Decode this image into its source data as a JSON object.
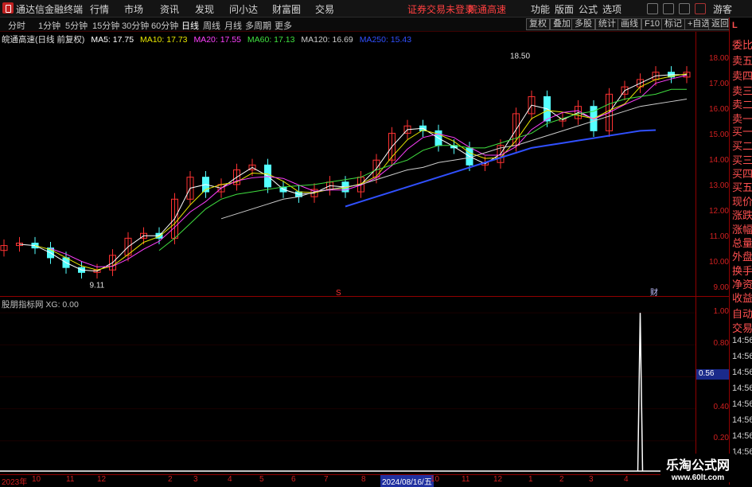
{
  "menubar": {
    "app_title": "通达信金融终端",
    "menus": [
      "行情",
      "市场",
      "资讯",
      "发现",
      "问小达",
      "财富圈",
      "交易"
    ],
    "notice": "证券交易未登录",
    "stock_name": "皖通高速",
    "right_menus": [
      "功能",
      "版面",
      "公式",
      "选项"
    ],
    "user": "游客"
  },
  "toolbar": {
    "periods": [
      "分时",
      "1分钟",
      "5分钟",
      "15分钟",
      "30分钟",
      "60分钟",
      "日线",
      "周线",
      "月线",
      "多周期",
      "更多"
    ],
    "selected": "日线",
    "buttons": [
      "复权",
      "叠加",
      "多股",
      "统计",
      "画线",
      "F10",
      "标记",
      "+自选",
      "返回"
    ]
  },
  "ma_legend": {
    "title": "皖通高速(日线 前复权)",
    "items": [
      {
        "label": "MA5: 17.75",
        "color": "#ffffff"
      },
      {
        "label": "MA10: 17.73",
        "color": "#e6e600"
      },
      {
        "label": "MA20: 17.55",
        "color": "#ff40ff"
      },
      {
        "label": "MA60: 17.13",
        "color": "#40e040"
      },
      {
        "label": "MA120: 16.69",
        "color": "#cccccc"
      },
      {
        "label": "MA250: 15.43",
        "color": "#3050ff"
      }
    ]
  },
  "main_yaxis": [
    "18.00",
    "17.00",
    "16.00",
    "15.00",
    "14.00",
    "13.00",
    "12.00",
    "11.00",
    "10.00",
    "9.00"
  ],
  "annotations": {
    "high": "18.50",
    "low": "9.11",
    "marker_s": "S",
    "marker_cai": "财"
  },
  "indicator": {
    "legend": "股朋指标网 XG: 0.00",
    "yaxis": [
      "1.00",
      "0.80",
      "0.60",
      "0.40",
      "0.20"
    ],
    "current_value": "0.56"
  },
  "right_panel": [
    "L",
    "委比",
    "卖五",
    "卖四",
    "卖三",
    "卖二",
    "卖一",
    "买一",
    "买二",
    "买三",
    "买四",
    "买五",
    "现价",
    "涨跌",
    "涨幅",
    "总量",
    "外盘",
    "换手",
    "净资",
    "收益",
    "自动",
    "交易",
    "14:56",
    "14:56",
    "14:56",
    "14:56",
    "14:56",
    "14:56",
    "14:56",
    "14:56"
  ],
  "xaxis": [
    "2023年",
    "10",
    "11",
    "12",
    "2",
    "3",
    "4",
    "5",
    "6",
    "7",
    "8",
    "9",
    "2024/08/16/五",
    "10",
    "11",
    "12",
    "1",
    "2",
    "3",
    "4"
  ],
  "watermark": {
    "title": "乐淘公式网",
    "url": "www.60lt.com"
  },
  "chart_data": {
    "type": "candlestick",
    "ylim": [
      8.6,
      18.9
    ],
    "ma_series": [
      "MA5",
      "MA10",
      "MA20",
      "MA60",
      "MA120",
      "MA250"
    ],
    "close": [
      10.7,
      10.8,
      10.6,
      10.2,
      9.8,
      9.6,
      9.7,
      10.3,
      11.0,
      11.2,
      11.0,
      12.6,
      13.5,
      12.9,
      13.2,
      13.8,
      14.0,
      13.1,
      12.9,
      12.7,
      13.0,
      13.3,
      12.9,
      13.5,
      14.2,
      15.3,
      15.6,
      15.4,
      14.8,
      14.7,
      14.0,
      14.1,
      14.8,
      16.1,
      16.8,
      15.8,
      15.9,
      16.4,
      15.4,
      16.9,
      17.2,
      17.5,
      17.8,
      17.6,
      17.8
    ],
    "ma60": [
      null,
      null,
      null,
      null,
      null,
      null,
      null,
      null,
      null,
      null,
      10.5,
      11.0,
      11.6,
      12.2,
      12.6,
      12.8,
      12.9,
      13.0,
      13.1,
      13.15,
      13.2,
      13.3,
      13.4,
      13.5,
      13.8,
      14.0,
      14.2,
      14.6,
      14.8,
      14.8,
      14.7,
      14.7,
      14.9,
      15.1,
      15.3,
      15.7,
      15.9,
      16.1,
      16.2,
      16.5,
      16.7,
      16.8,
      16.9,
      17.1,
      17.1
    ],
    "ma120": [
      null,
      null,
      null,
      null,
      null,
      null,
      null,
      null,
      null,
      null,
      null,
      null,
      null,
      null,
      11.8,
      12.0,
      12.2,
      12.4,
      12.6,
      12.7,
      12.9,
      13.0,
      13.1,
      13.2,
      13.4,
      13.6,
      13.8,
      13.9,
      14.1,
      14.2,
      14.3,
      14.5,
      14.7,
      14.8,
      15.0,
      15.2,
      15.4,
      15.6,
      15.8,
      16.0,
      16.2,
      16.4,
      16.5,
      16.6,
      16.7
    ],
    "ma250": [
      null,
      null,
      null,
      null,
      null,
      null,
      null,
      null,
      null,
      null,
      null,
      null,
      null,
      null,
      null,
      null,
      null,
      null,
      null,
      null,
      null,
      null,
      12.3,
      12.5,
      12.7,
      12.9,
      13.1,
      13.3,
      13.5,
      13.7,
      13.9,
      14.1,
      14.3,
      14.5,
      14.7,
      14.8,
      14.9,
      15.0,
      15.1,
      15.2,
      15.3,
      15.4,
      15.43,
      null,
      null
    ],
    "signal_index": 41,
    "signal_value": 1.0
  }
}
